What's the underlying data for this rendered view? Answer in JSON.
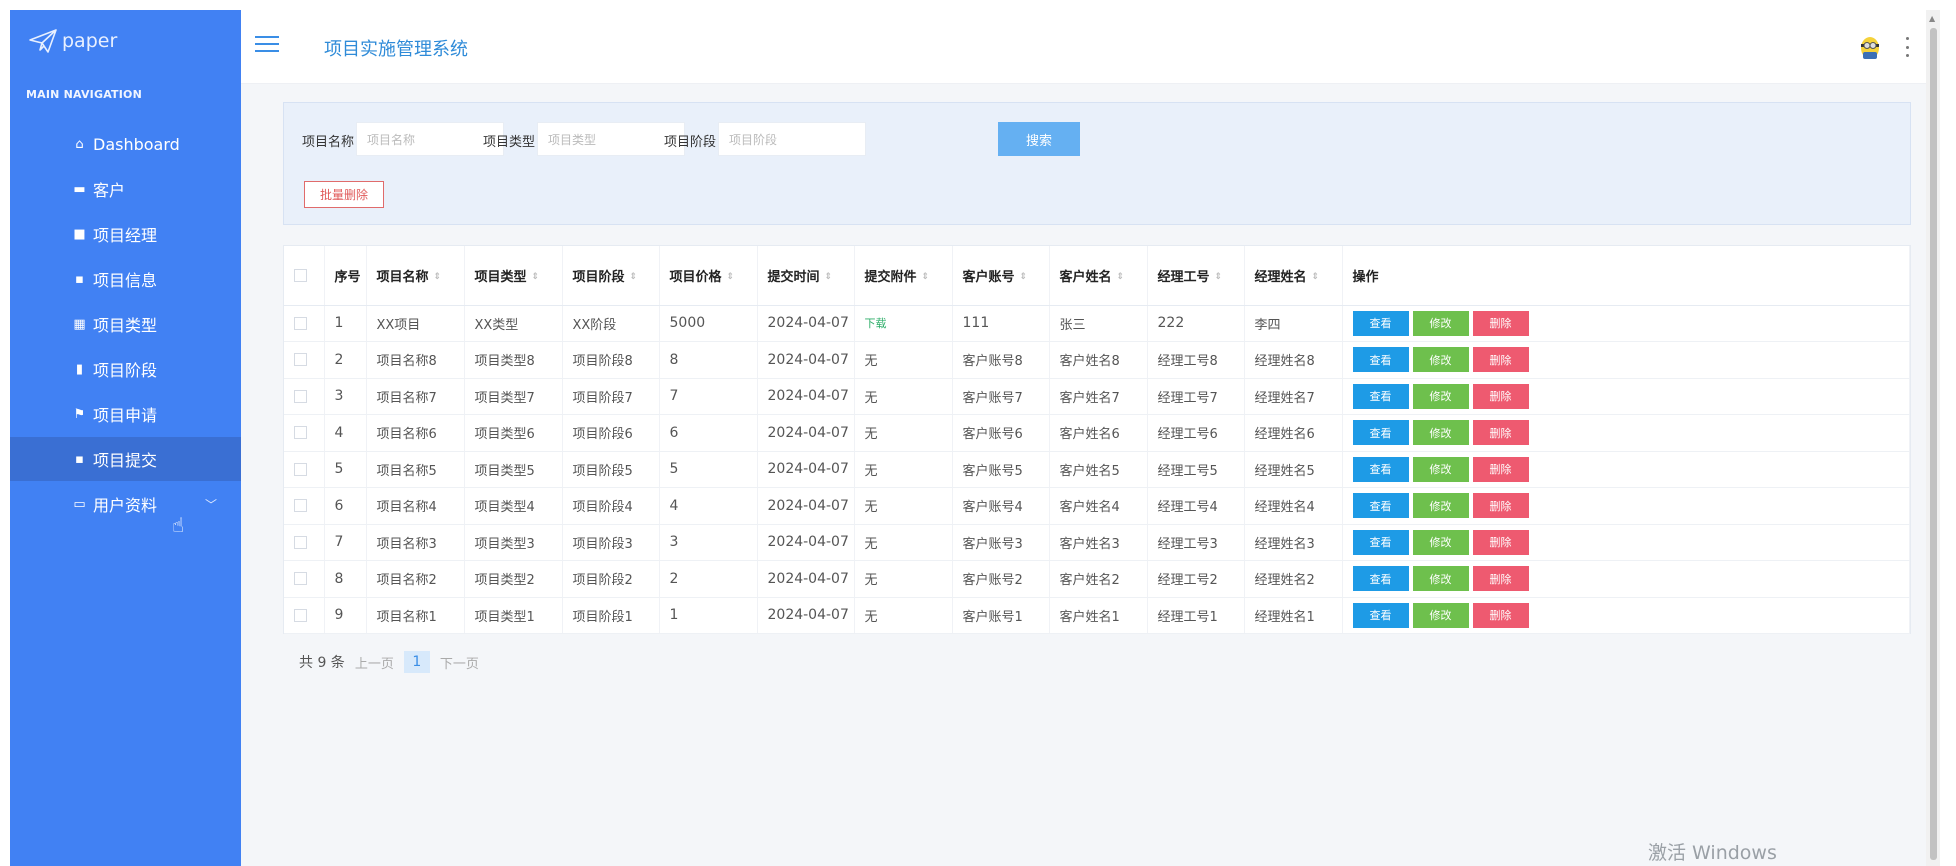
{
  "app": {
    "logo_text": "paper",
    "title": "项目实施管理系统"
  },
  "sidebar": {
    "nav_title": "MAIN NAVIGATION",
    "items": [
      {
        "label": "Dashboard",
        "icon": "home-icon"
      },
      {
        "label": "客户",
        "icon": "briefcase-icon"
      },
      {
        "label": "项目经理",
        "icon": "comment-icon"
      },
      {
        "label": "项目信息",
        "icon": "grid-icon"
      },
      {
        "label": "项目类型",
        "icon": "table-icon"
      },
      {
        "label": "项目阶段",
        "icon": "bar-chart-icon"
      },
      {
        "label": "项目申请",
        "icon": "flag-icon"
      },
      {
        "label": "项目提交",
        "icon": "grid-icon"
      },
      {
        "label": "用户资料",
        "icon": "id-card-icon"
      }
    ],
    "active_index": 7
  },
  "search": {
    "fields": [
      {
        "label": "项目名称",
        "placeholder": "项目名称"
      },
      {
        "label": "项目类型",
        "placeholder": "项目类型"
      },
      {
        "label": "项目阶段",
        "placeholder": "项目阶段"
      }
    ],
    "search_button": "搜索",
    "batch_delete": "批量删除"
  },
  "table": {
    "columns": [
      "序号",
      "项目名称",
      "项目类型",
      "项目阶段",
      "项目价格",
      "提交时间",
      "提交附件",
      "客户账号",
      "客户姓名",
      "经理工号",
      "经理姓名",
      "操作"
    ],
    "rows": [
      [
        "1",
        "XX项目",
        "XX类型",
        "XX阶段",
        "5000",
        "2024-04-07",
        "下载",
        "111",
        "张三",
        "222",
        "李四"
      ],
      [
        "2",
        "项目名称8",
        "项目类型8",
        "项目阶段8",
        "8",
        "2024-04-07",
        "无",
        "客户账号8",
        "客户姓名8",
        "经理工号8",
        "经理姓名8"
      ],
      [
        "3",
        "项目名称7",
        "项目类型7",
        "项目阶段7",
        "7",
        "2024-04-07",
        "无",
        "客户账号7",
        "客户姓名7",
        "经理工号7",
        "经理姓名7"
      ],
      [
        "4",
        "项目名称6",
        "项目类型6",
        "项目阶段6",
        "6",
        "2024-04-07",
        "无",
        "客户账号6",
        "客户姓名6",
        "经理工号6",
        "经理姓名6"
      ],
      [
        "5",
        "项目名称5",
        "项目类型5",
        "项目阶段5",
        "5",
        "2024-04-07",
        "无",
        "客户账号5",
        "客户姓名5",
        "经理工号5",
        "经理姓名5"
      ],
      [
        "6",
        "项目名称4",
        "项目类型4",
        "项目阶段4",
        "4",
        "2024-04-07",
        "无",
        "客户账号4",
        "客户姓名4",
        "经理工号4",
        "经理姓名4"
      ],
      [
        "7",
        "项目名称3",
        "项目类型3",
        "项目阶段3",
        "3",
        "2024-04-07",
        "无",
        "客户账号3",
        "客户姓名3",
        "经理工号3",
        "经理姓名3"
      ],
      [
        "8",
        "项目名称2",
        "项目类型2",
        "项目阶段2",
        "2",
        "2024-04-07",
        "无",
        "客户账号2",
        "客户姓名2",
        "经理工号2",
        "经理姓名2"
      ],
      [
        "9",
        "项目名称1",
        "项目类型1",
        "项目阶段1",
        "1",
        "2024-04-07",
        "无",
        "客户账号1",
        "客户姓名1",
        "经理工号1",
        "经理姓名1"
      ]
    ],
    "actions": {
      "view": "查看",
      "edit": "修改",
      "delete": "删除"
    }
  },
  "pager": {
    "total": "共 9 条",
    "prev": "上一页",
    "current": "1",
    "next": "下一页"
  },
  "watermark": "激活 Windows",
  "colors": {
    "sidebar": "#4181f3",
    "accent": "#2f8bd8",
    "view": "#1e9be6",
    "edit": "#6ec04d",
    "delete": "#ee5a70"
  }
}
